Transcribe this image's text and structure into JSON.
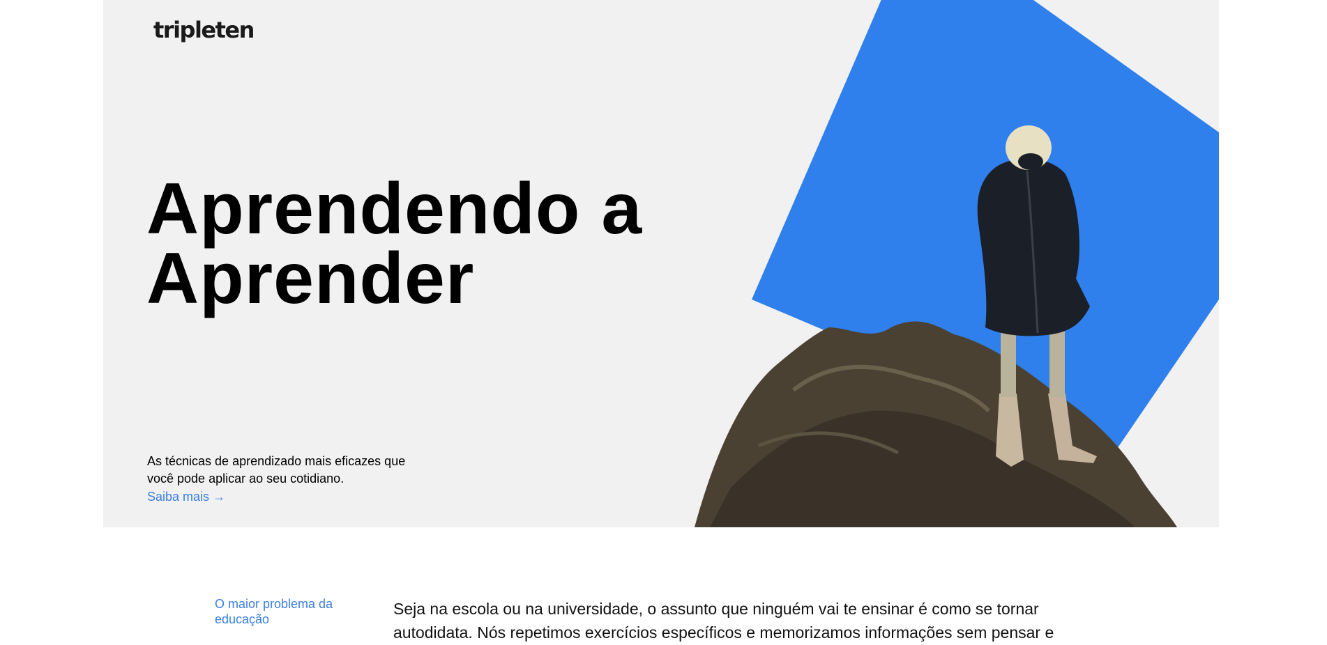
{
  "brand": {
    "logo_text": "tripleten"
  },
  "hero": {
    "title_line1": "Aprendendo a",
    "title_line2": "Aprender",
    "subtitle": "As técnicas de aprendizado mais eficazes que você pode aplicar ao seu cotidiano.",
    "link_label": "Saiba mais →",
    "accent_color": "#2f7fec",
    "background_color": "#f1f1f1"
  },
  "section": {
    "side_label": "O maior problema da educação",
    "body": "Seja na escola ou na universidade, o assunto que ninguém vai te ensinar é como se tornar autodidata. Nós repetimos exercícios específicos e memorizamos informações sem pensar e"
  },
  "colors": {
    "link": "#3a7ee3",
    "text": "#000000"
  }
}
